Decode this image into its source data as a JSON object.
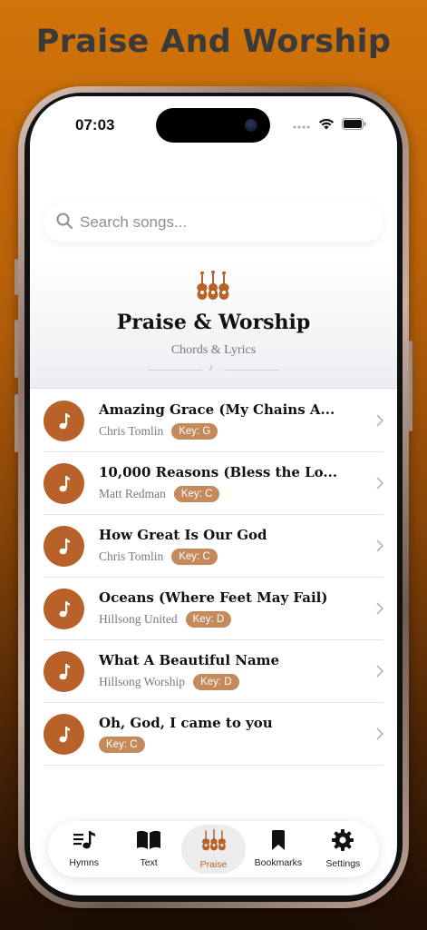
{
  "promo": {
    "title": "Praise And Worship"
  },
  "status_bar": {
    "time": "07:03"
  },
  "search": {
    "placeholder": "Search songs..."
  },
  "header": {
    "title": "Praise & Worship",
    "subtitle": "Chords & Lyrics"
  },
  "colors": {
    "accent": "#b8622a",
    "badge": "#c58a5b"
  },
  "songs": [
    {
      "title": "Amazing Grace (My Chains A...",
      "artist": "Chris Tomlin",
      "key": "Key: G"
    },
    {
      "title": "10,000 Reasons (Bless the Lo...",
      "artist": "Matt Redman",
      "key": "Key: C"
    },
    {
      "title": "How Great Is Our God",
      "artist": "Chris Tomlin",
      "key": "Key: C"
    },
    {
      "title": "Oceans (Where Feet May Fail)",
      "artist": "Hillsong United",
      "key": "Key: D"
    },
    {
      "title": "What A Beautiful Name",
      "artist": "Hillsong Worship",
      "key": "Key: D"
    },
    {
      "title": "Oh, God, I came to you",
      "artist": "",
      "key": "Key: C"
    }
  ],
  "tabs": [
    {
      "label": "Hymns",
      "icon": "music-note-list-icon"
    },
    {
      "label": "Text",
      "icon": "book-icon"
    },
    {
      "label": "Praise",
      "icon": "guitars-icon",
      "active": true
    },
    {
      "label": "Bookmarks",
      "icon": "bookmark-icon"
    },
    {
      "label": "Settings",
      "icon": "gear-icon"
    }
  ]
}
